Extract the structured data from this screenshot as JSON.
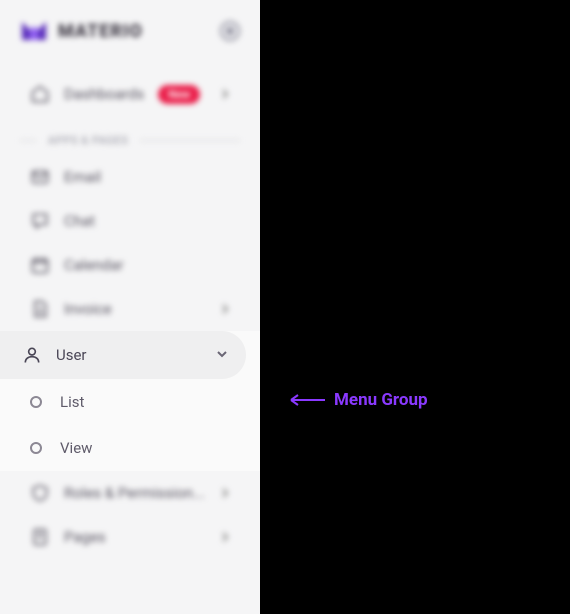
{
  "brand": {
    "name": "MATERIO"
  },
  "nav": {
    "dashboards": {
      "label": "Dashboards",
      "badge": "New"
    },
    "section_apps": "APPS & PAGES",
    "email": "Email",
    "chat": "Chat",
    "calendar": "Calendar",
    "invoice": "Invoice",
    "user": {
      "label": "User",
      "children": {
        "list": "List",
        "view": "View"
      }
    },
    "roles": "Roles & Permission...",
    "pages": "Pages"
  },
  "annotation": {
    "label": "Menu Group"
  }
}
